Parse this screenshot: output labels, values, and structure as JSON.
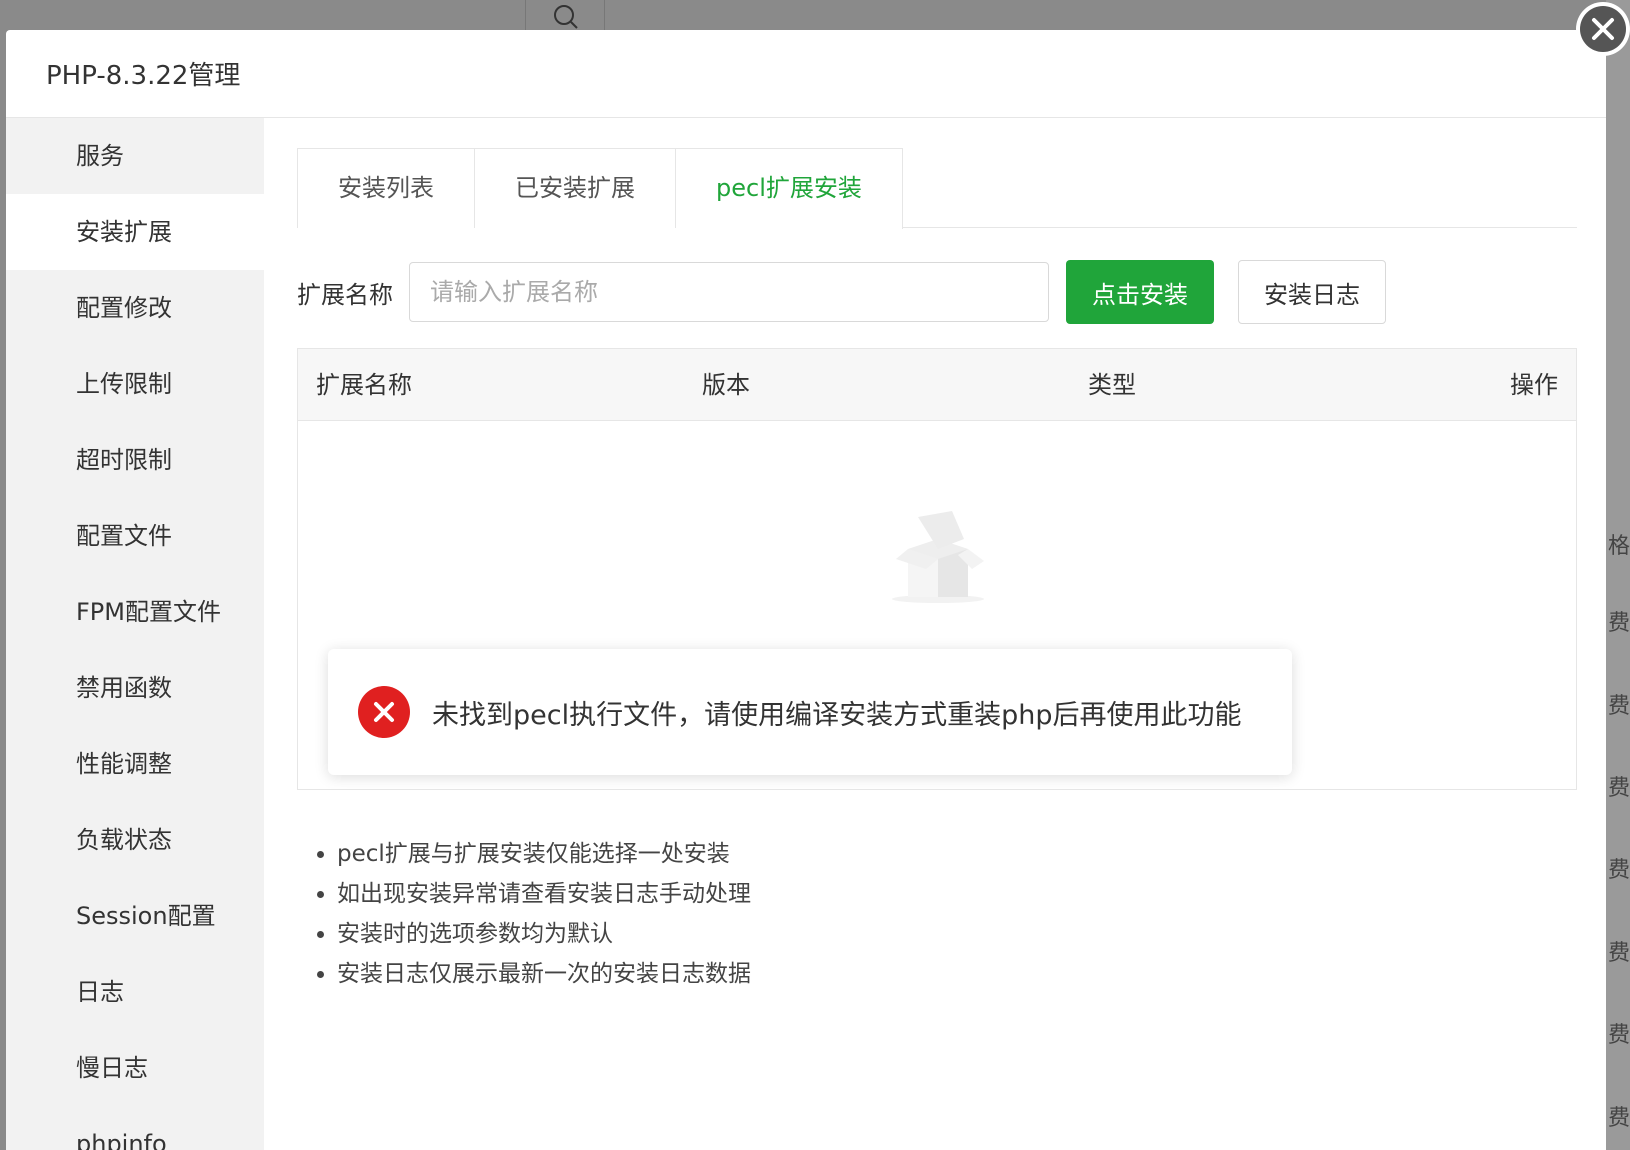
{
  "dialog": {
    "title": "PHP-8.3.22管理",
    "close_icon": "close-icon"
  },
  "sidebar": {
    "items": [
      {
        "label": "服务"
      },
      {
        "label": "安装扩展"
      },
      {
        "label": "配置修改"
      },
      {
        "label": "上传限制"
      },
      {
        "label": "超时限制"
      },
      {
        "label": "配置文件"
      },
      {
        "label": "FPM配置文件"
      },
      {
        "label": "禁用函数"
      },
      {
        "label": "性能调整"
      },
      {
        "label": "负载状态"
      },
      {
        "label": "Session配置"
      },
      {
        "label": "日志"
      },
      {
        "label": "慢日志"
      },
      {
        "label": "phpinfo"
      }
    ],
    "active_index": 1
  },
  "tabs": [
    {
      "label": "安装列表"
    },
    {
      "label": "已安装扩展"
    },
    {
      "label": "pecl扩展安装"
    }
  ],
  "active_tab": 2,
  "form": {
    "label": "扩展名称",
    "placeholder": "请输入扩展名称",
    "value": "",
    "install_button": "点击安装",
    "log_button": "安装日志"
  },
  "table": {
    "columns": [
      "扩展名称",
      "版本",
      "类型",
      "操作"
    ],
    "rows": []
  },
  "toast": {
    "message": "未找到pecl执行文件，请使用编译安装方式重装php后再使用此功能",
    "icon": "error-icon"
  },
  "notes": [
    "pecl扩展与扩展安装仅能选择一处安装",
    "如出现安装异常请查看安装日志手动处理",
    "安装时的选项参数均为默认",
    "安装日志仅展示最新一次的安装日志数据"
  ],
  "background": {
    "right_texts": [
      "格",
      "费",
      "费",
      "费",
      "费",
      "费",
      "费",
      "费"
    ]
  },
  "colors": {
    "accent": "#20a53a",
    "error": "#e02020"
  }
}
